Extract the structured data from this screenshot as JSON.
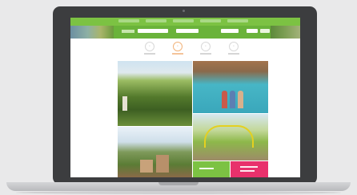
{
  "device": "laptop",
  "website": {
    "header": {
      "nav_items": [
        "",
        "",
        "",
        "",
        ""
      ],
      "color": "#7cc243"
    },
    "search_bar": {
      "fields": [
        "",
        "",
        "",
        ""
      ],
      "button": ""
    },
    "categories": [
      {
        "icon": "walk-icon",
        "label": "",
        "active": false
      },
      {
        "icon": "family-icon",
        "label": "",
        "active": true
      },
      {
        "icon": "leisure-icon",
        "label": "",
        "active": false
      },
      {
        "icon": "event-icon",
        "label": "",
        "active": false
      }
    ],
    "photos": [
      "hills",
      "pool",
      "playground",
      "village"
    ],
    "tiles": [
      {
        "color": "#7cc243",
        "label": ""
      },
      {
        "color": "#e8316c",
        "label": ""
      }
    ]
  }
}
